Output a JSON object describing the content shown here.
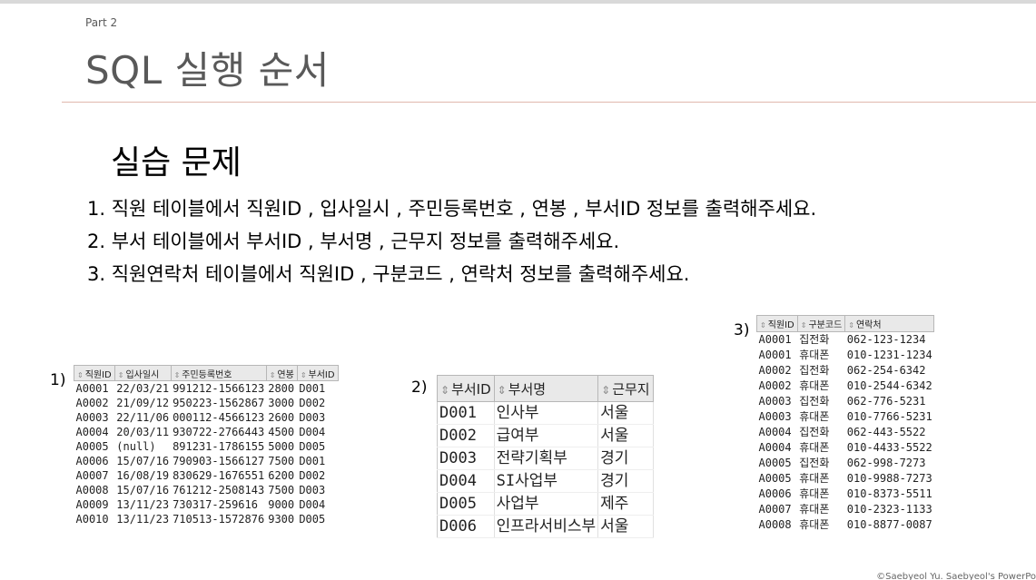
{
  "header": {
    "part": "Part 2",
    "title": "SQL 실행 순서"
  },
  "section": {
    "title": "실습 문제"
  },
  "tasks": [
    "1.  직원 테이블에서 직원ID , 입사일시 , 주민등록번호 , 연봉 , 부서ID 정보를 출력해주세요.",
    "2.  부서 테이블에서 부서ID , 부서명 , 근무지 정보를 출력해주세요.",
    "3.  직원연락처 테이블에서 직원ID , 구분코드 , 연락처 정보를 출력해주세요."
  ],
  "table1": {
    "label": "1)",
    "columns": [
      "직원ID",
      "입사일시",
      "주민등록번호",
      "연봉",
      "부서ID"
    ],
    "rows": [
      [
        "A0001",
        "22/03/21",
        "991212-1566123",
        "2800",
        "D001"
      ],
      [
        "A0002",
        "21/09/12",
        "950223-1562867",
        "3000",
        "D002"
      ],
      [
        "A0003",
        "22/11/06",
        "000112-4566123",
        "2600",
        "D003"
      ],
      [
        "A0004",
        "20/03/11",
        "930722-2766443",
        "4500",
        "D004"
      ],
      [
        "A0005",
        "(null)",
        "891231-1786155",
        "5000",
        "D005"
      ],
      [
        "A0006",
        "15/07/16",
        "790903-1566127",
        "7500",
        "D001"
      ],
      [
        "A0007",
        "16/08/19",
        "830629-1676551",
        "6200",
        "D002"
      ],
      [
        "A0008",
        "15/07/16",
        "761212-2508143",
        "7500",
        "D003"
      ],
      [
        "A0009",
        "13/11/23",
        "730317-259616",
        "9000",
        "D004"
      ],
      [
        "A0010",
        "13/11/23",
        "710513-1572876",
        "9300",
        "D005"
      ]
    ]
  },
  "table2": {
    "label": "2)",
    "columns": [
      "부서ID",
      "부서명",
      "근무지"
    ],
    "rows": [
      [
        "D001",
        "인사부",
        "서울"
      ],
      [
        "D002",
        "급여부",
        "서울"
      ],
      [
        "D003",
        "전략기획부",
        "경기"
      ],
      [
        "D004",
        "SI사업부",
        "경기"
      ],
      [
        "D005",
        "사업부",
        "제주"
      ],
      [
        "D006",
        "인프라서비스부",
        "서울"
      ]
    ]
  },
  "table3": {
    "label": "3)",
    "columns": [
      "직원ID",
      "구분코드",
      "연락처"
    ],
    "rows": [
      [
        "A0001",
        "집전화",
        "062-123-1234"
      ],
      [
        "A0001",
        "휴대폰",
        "010-1231-1234"
      ],
      [
        "A0002",
        "집전화",
        "062-254-6342"
      ],
      [
        "A0002",
        "휴대폰",
        "010-2544-6342"
      ],
      [
        "A0003",
        "집전화",
        "062-776-5231"
      ],
      [
        "A0003",
        "휴대폰",
        "010-7766-5231"
      ],
      [
        "A0004",
        "집전화",
        "062-443-5522"
      ],
      [
        "A0004",
        "휴대폰",
        "010-4433-5522"
      ],
      [
        "A0005",
        "집전화",
        "062-998-7273"
      ],
      [
        "A0005",
        "휴대폰",
        "010-9988-7273"
      ],
      [
        "A0006",
        "휴대폰",
        "010-8373-5511"
      ],
      [
        "A0007",
        "휴대폰",
        "010-2323-1133"
      ],
      [
        "A0008",
        "휴대폰",
        "010-8877-0087"
      ]
    ]
  },
  "footer": {
    "text": "©Saebyeol Yu. Saebyeol's PowerPo"
  }
}
